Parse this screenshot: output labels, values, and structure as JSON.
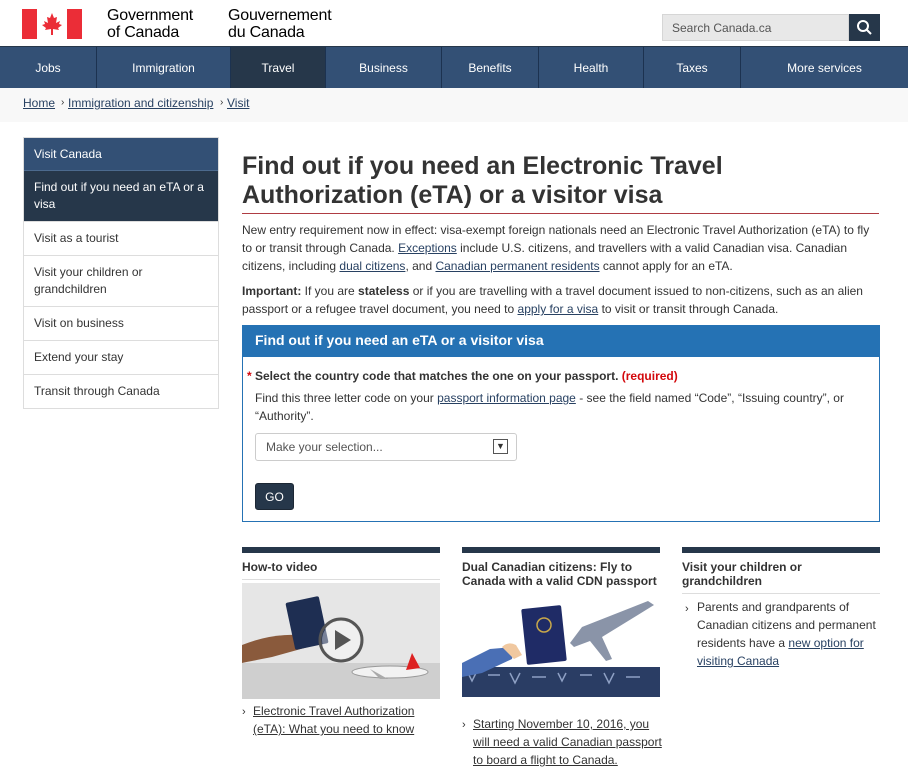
{
  "header": {
    "wordmark_en_line1": "Government",
    "wordmark_en_line2": "of Canada",
    "wordmark_fr_line1": "Gouvernement",
    "wordmark_fr_line2": "du Canada",
    "search_placeholder": "Search Canada.ca"
  },
  "nav": {
    "items": [
      "Jobs",
      "Immigration",
      "Travel",
      "Business",
      "Benefits",
      "Health",
      "Taxes",
      "More services"
    ],
    "active": "Travel"
  },
  "breadcrumb": [
    "Home",
    "Immigration and citizenship",
    "Visit"
  ],
  "sidebar": {
    "heading": "Visit Canada",
    "items": [
      "Find out if you need an eTA or a visa",
      "Visit as a tourist",
      "Visit your children or grandchildren",
      "Visit on business",
      "Extend your stay",
      "Transit through Canada"
    ]
  },
  "main": {
    "title": "Find out if you need an Electronic Travel Authorization (eTA) or a visitor visa",
    "intro_part1": "New entry requirement now in effect: visa-exempt foreign nationals need an Electronic Travel Authorization (eTA) to fly to or transit through Canada. ",
    "intro_link1": "Exceptions",
    "intro_part2": " include U.S. citizens, and travellers with a valid Canadian visa. Canadian citizens, including ",
    "intro_link2": "dual citizens",
    "intro_part3": ", and ",
    "intro_link3": "Canadian permanent residents",
    "intro_part4": " cannot apply for an eTA.",
    "important_label": "Important:",
    "important_part1": " If you are ",
    "important_bold": "stateless",
    "important_part2": " or if you are travelling with a travel document issued to non-citizens, such as an alien passport or a refugee travel document, you need to ",
    "important_link": "apply for a visa",
    "important_part3": " to visit or transit through Canada."
  },
  "panel": {
    "heading": "Find out if you need an eTA or a visitor visa",
    "required_star": "*",
    "question": " Select the country code that matches the one on your passport. ",
    "required_tag": "(required)",
    "help_part1": "Find this three letter code on your ",
    "help_link": "passport information page",
    "help_part2": " - see the field named “Code”, “Issuing country”, or “Authority”.",
    "select_value": "Make your selection...",
    "go_label": "GO"
  },
  "features": [
    {
      "title": "How-to video",
      "link": "Electronic Travel Authorization (eTA): What you need to know"
    },
    {
      "title": "Dual Canadian citizens: Fly to Canada with a valid CDN passport",
      "link": "Starting November 10, 2016, you will need a valid Canadian passport to board a flight to Canada."
    },
    {
      "title": "Visit your children or grandchildren",
      "text": "Parents and grandparents of Canadian citizens and permanent residents have a ",
      "link": "new option for visiting Canada"
    }
  ],
  "colors": {
    "nav_bg": "#335075",
    "nav_active": "#26374a",
    "panel_blue": "#2572b4",
    "title_rule": "#af3c43",
    "required_red": "#d3080c"
  },
  "icons": [
    "canada-flag-icon",
    "search-icon",
    "chevron-right-icon",
    "play-icon",
    "dropdown-arrow-icon"
  ]
}
